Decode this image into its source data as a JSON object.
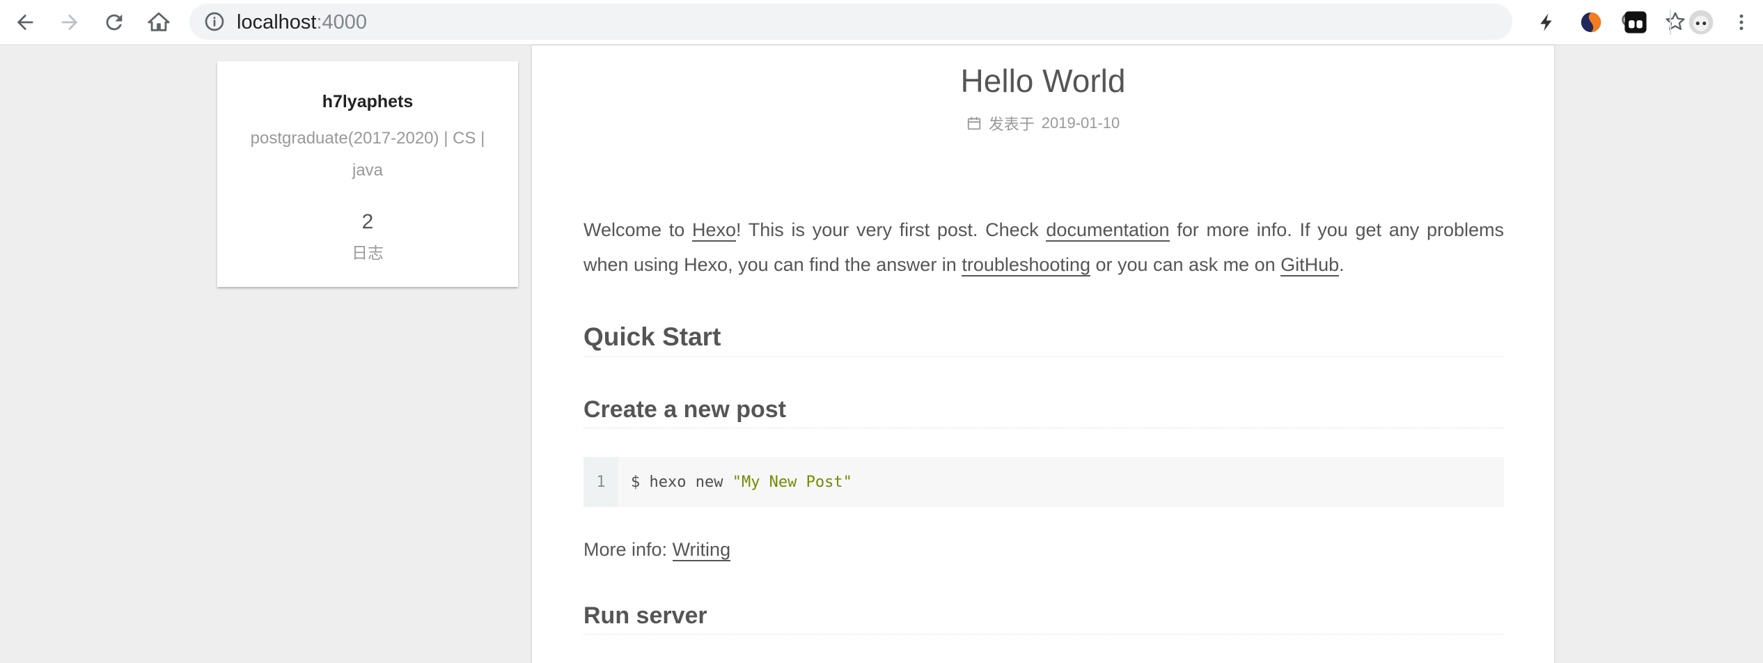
{
  "browser": {
    "url_host": "localhost",
    "url_port": ":4000",
    "icons": [
      "back-arrow-icon",
      "forward-arrow-icon",
      "reload-icon",
      "home-icon",
      "info-icon",
      "zoom-out-icon",
      "star-icon",
      "lightning-extension-icon",
      "orange-blue-extension-icon",
      "dark-square-extension-icon",
      "profile-avatar-icon",
      "more-vertical-icon"
    ]
  },
  "sidebar": {
    "author": "h7lyaphets",
    "description": "postgraduate(2017-2020) | CS | java",
    "post_count": "2",
    "post_count_label": "日志"
  },
  "post": {
    "title": "Hello World",
    "meta_label": "发表于",
    "date": "2019-01-10",
    "intro": {
      "t1": "Welcome to ",
      "link1": "Hexo",
      "t2": "! This is your very first post. Check ",
      "link2": "documentation",
      "t3": " for more info. If you get any problems when using Hexo, you can find the answer in ",
      "link3": "troubleshooting",
      "t4": " or you can ask me on ",
      "link4": "GitHub",
      "t5": "."
    },
    "h_quick_start": "Quick Start",
    "h_create_post": "Create a new post",
    "code": {
      "line_no": "1",
      "cmd": "$ hexo new ",
      "arg": "\"My New Post\""
    },
    "more_info_label": "More info: ",
    "more_info_link": "Writing",
    "h_run_server": "Run server"
  },
  "colors": {
    "page_bg": "#eeeeee",
    "text": "#555555",
    "muted": "#999999",
    "code_string": "#718c00"
  }
}
